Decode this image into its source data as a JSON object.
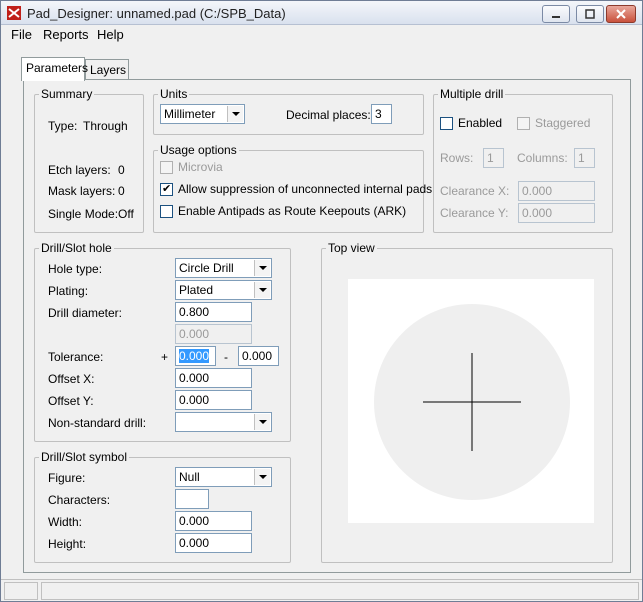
{
  "window": {
    "title": "Pad_Designer: unnamed.pad (C:/SPB_Data)"
  },
  "menu": {
    "items": [
      "File",
      "Reports",
      "Help"
    ]
  },
  "tabs": [
    {
      "label": "Parameters",
      "active": true
    },
    {
      "label": "Layers",
      "active": false
    }
  ],
  "summary": {
    "legend": "Summary",
    "type_label": "Type:",
    "type_value": "Through",
    "etch_label": "Etch layers:",
    "etch_value": "0",
    "mask_label": "Mask layers:",
    "mask_value": "0",
    "single_label": "Single Mode:",
    "single_value": "Off"
  },
  "units": {
    "legend": "Units",
    "unit_value": "Millimeter",
    "decimal_label": "Decimal places:",
    "decimal_value": "3"
  },
  "usage": {
    "legend": "Usage options",
    "microvia_label": "Microvia",
    "allow_label": "Allow suppression of unconnected internal pads",
    "antipads_label": "Enable Antipads as Route Keepouts (ARK)"
  },
  "multiple_drill": {
    "legend": "Multiple drill",
    "enabled_label": "Enabled",
    "staggered_label": "Staggered",
    "rows_label": "Rows:",
    "rows_value": "1",
    "columns_label": "Columns:",
    "columns_value": "1",
    "clearance_x_label": "Clearance X:",
    "clearance_x_value": "0.000",
    "clearance_y_label": "Clearance Y:",
    "clearance_y_value": "0.000"
  },
  "drill_hole": {
    "legend": "Drill/Slot hole",
    "hole_type_label": "Hole type:",
    "hole_type_value": "Circle Drill",
    "plating_label": "Plating:",
    "plating_value": "Plated",
    "diameter_label": "Drill diameter:",
    "diameter_value": "0.800",
    "secondary_value": "0.000",
    "tolerance_label": "Tolerance:",
    "plus_sign": "+",
    "tol_plus_value": "0.000",
    "minus_sign": "-",
    "tol_minus_value": "0.000",
    "offset_x_label": "Offset X:",
    "offset_x_value": "0.000",
    "offset_y_label": "Offset Y:",
    "offset_y_value": "0.000",
    "nonstd_label": "Non-standard drill:",
    "nonstd_value": ""
  },
  "drill_symbol": {
    "legend": "Drill/Slot symbol",
    "figure_label": "Figure:",
    "figure_value": "Null",
    "characters_label": "Characters:",
    "characters_value": "",
    "width_label": "Width:",
    "width_value": "0.000",
    "height_label": "Height:",
    "height_value": "0.000"
  },
  "top_view": {
    "legend": "Top view"
  }
}
